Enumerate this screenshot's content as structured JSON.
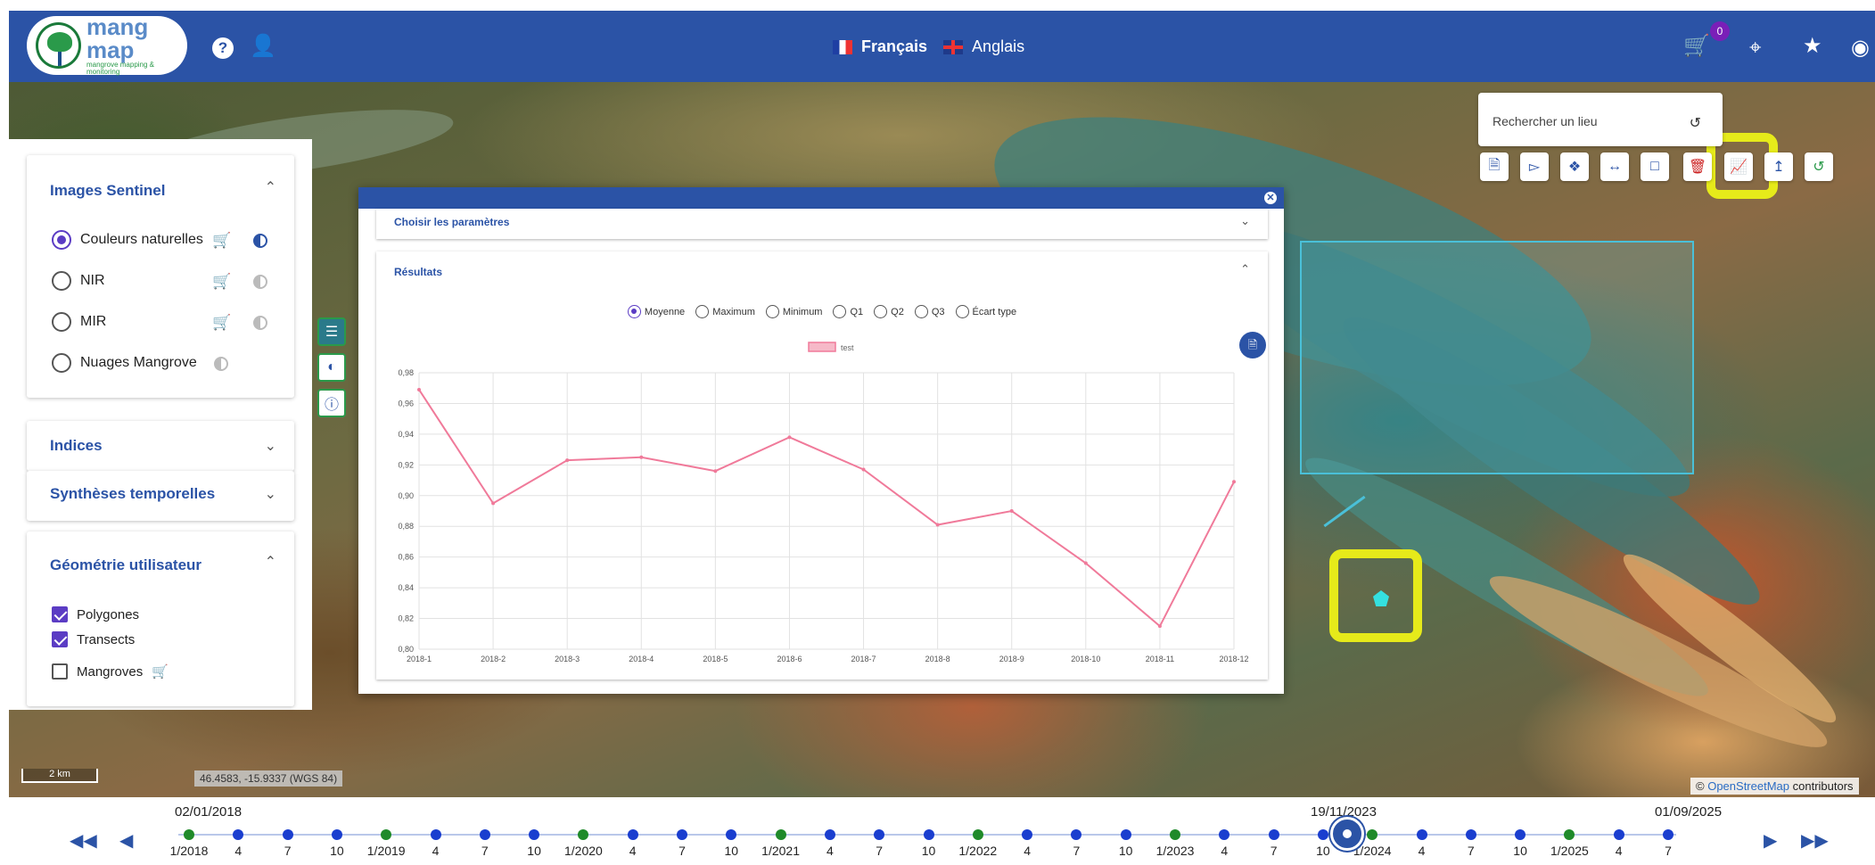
{
  "header": {
    "logo_line1": "mang",
    "logo_line2": "map",
    "logo_tagline": "mangrove mapping & monitoring",
    "lang_active": "Français",
    "lang_other": "Anglais",
    "cart_count": "0"
  },
  "left_panel": {
    "sentinel": {
      "title": "Images Sentinel",
      "options": [
        "Couleurs naturelles",
        "NIR",
        "MIR",
        "Nuages Mangrove"
      ],
      "selected": "Couleurs naturelles"
    },
    "indices_title": "Indices",
    "syntheses_title": "Synthèses temporelles",
    "geometry": {
      "title": "Géométrie utilisateur",
      "items": [
        {
          "label": "Polygones",
          "checked": true
        },
        {
          "label": "Transects",
          "checked": true
        },
        {
          "label": "Mangroves",
          "checked": false
        }
      ]
    }
  },
  "dialog": {
    "params_title": "Choisir les paramètres",
    "results_title": "Résultats",
    "stats": [
      "Moyenne",
      "Maximum",
      "Minimum",
      "Q1",
      "Q2",
      "Q3",
      "Écart type"
    ],
    "selected_stat": "Moyenne"
  },
  "chart_data": {
    "type": "line",
    "categories": [
      "2018-1",
      "2018-2",
      "2018-3",
      "2018-4",
      "2018-5",
      "2018-6",
      "2018-7",
      "2018-8",
      "2018-9",
      "2018-10",
      "2018-11",
      "2018-12"
    ],
    "series": [
      {
        "name": "test",
        "values": [
          0.969,
          0.895,
          0.923,
          0.925,
          0.916,
          0.938,
          0.917,
          0.881,
          0.89,
          0.856,
          0.815,
          0.909
        ]
      }
    ],
    "yticks": [
      "0,80",
      "0,82",
      "0,84",
      "0,86",
      "0,88",
      "0,90",
      "0,92",
      "0,94",
      "0,96",
      "0,98"
    ],
    "ylim": [
      0.8,
      0.98
    ],
    "grid": true,
    "legend": "top-center",
    "color": "#f07a9a"
  },
  "search": {
    "placeholder": "Rechercher un lieu"
  },
  "map": {
    "scale": "2 km",
    "coords": "46.4583, -15.9337 (WGS 84)",
    "attribution_prefix": "©",
    "attribution_link": "OpenStreetMap",
    "attribution_suffix": "contributors"
  },
  "timeline": {
    "start_date": "02/01/2018",
    "current_date": "19/11/2023",
    "end_date": "01/09/2025",
    "labels": [
      "1/2018",
      "4",
      "7",
      "10",
      "1/2019",
      "4",
      "7",
      "10",
      "1/2020",
      "4",
      "7",
      "10",
      "1/2021",
      "4",
      "7",
      "10",
      "1/2022",
      "4",
      "7",
      "10",
      "1/2023",
      "4",
      "7",
      "10",
      "1/2024",
      "4",
      "7",
      "10",
      "1/2025",
      "4",
      "7"
    ]
  },
  "colors": {
    "brand": "#2b53a6",
    "accent": "#5b3cc4",
    "highlight": "#e6ea1a",
    "green": "#2a9a4a"
  }
}
